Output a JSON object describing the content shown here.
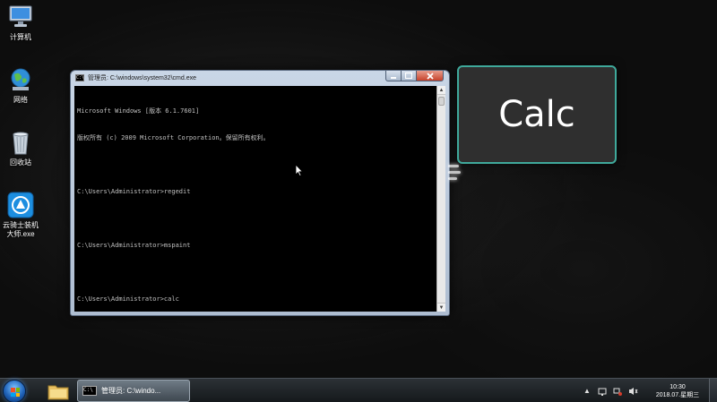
{
  "desktop": {
    "icons": [
      {
        "label": "计算机",
        "icon": "computer-icon"
      },
      {
        "label": "网络",
        "icon": "network-icon"
      },
      {
        "label": "回收站",
        "icon": "recycle-bin-icon"
      },
      {
        "label": "云骑士装机\n大师.exe",
        "icon": "cloud-knight-app-icon"
      }
    ]
  },
  "cmd_window": {
    "title": "管理员: C:\\windows\\system32\\cmd.exe",
    "icon_text": "C:\\",
    "console_lines": [
      "Microsoft Windows [版本 6.1.7601]",
      "版权所有 (c) 2009 Microsoft Corporation。保留所有权利。",
      "",
      "C:\\Users\\Administrator>regedit",
      "",
      "C:\\Users\\Administrator>mspaint",
      "",
      "C:\\Users\\Administrator>calc"
    ],
    "scroll_up": "▲",
    "scroll_down": "▼"
  },
  "overlay": {
    "label": "Calc",
    "accent": "#3fa99b"
  },
  "taskbar": {
    "cmd_button_label": "管理员: C:\\windo...",
    "cmd_icon_text": "C:\\",
    "tray_up_arrow": "▲",
    "clock_time": "10:30",
    "clock_date": "2018.07.星期三"
  }
}
